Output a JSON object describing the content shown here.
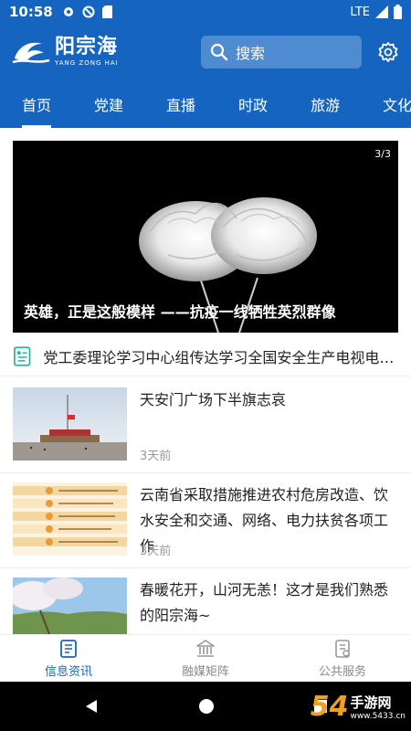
{
  "status_bar": {
    "time": "10:58",
    "network": "LTE"
  },
  "header": {
    "logo_cn": "阳宗海",
    "logo_en": "YANG ZONG HAI",
    "search_placeholder": "搜索"
  },
  "tabs": [
    {
      "label": "首页",
      "active": true
    },
    {
      "label": "党建"
    },
    {
      "label": "直播"
    },
    {
      "label": "时政"
    },
    {
      "label": "旅游"
    },
    {
      "label": "文化"
    }
  ],
  "banner": {
    "counter": "3/3",
    "caption": "英雄，正是这般模样 ——抗疫一线牺牲英烈群像"
  },
  "notice": {
    "text": "党工委理论学习中心组传达学习全国安全生产电视电话会议精神"
  },
  "news": [
    {
      "title": "天安门广场下半旗志哀",
      "time": "3天前"
    },
    {
      "title": "云南省采取措施推进农村危房改造、饮水安全和交通、网络、电力扶贫各项工作",
      "time": "3天前"
    },
    {
      "title": "春暖花开，山河无恙！这才是我们熟悉的阳宗海~",
      "time": ""
    }
  ],
  "bottom_nav": [
    {
      "label": "信息资讯",
      "icon": "news-icon",
      "active": true
    },
    {
      "label": "融媒矩阵",
      "icon": "bank-icon"
    },
    {
      "label": "公共服务",
      "icon": "service-icon"
    }
  ],
  "watermark": {
    "num": "54",
    "brand": "手游网",
    "domain": "www.5433.cn"
  },
  "colors": {
    "primary": "#1565c0",
    "text": "#222222",
    "muted": "#999999",
    "inactive": "#888888"
  }
}
